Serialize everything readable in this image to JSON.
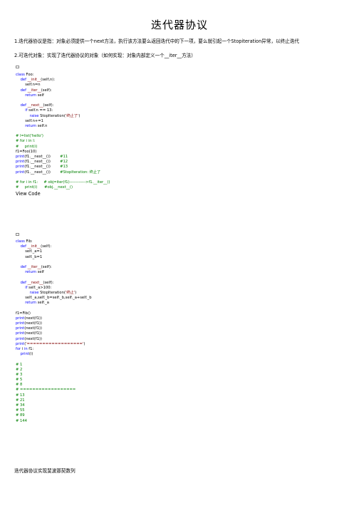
{
  "title": "迭代器协议",
  "paragraphs": [
    "1.迭代器协议是指：对象必须提供一个next方法，执行该方法要么返回迭代中的下一项，要么就引起一个Stopiteration异常，以终止迭代",
    "2.可迭代对象：实现了迭代器协议的对象（如何实现：对象内部定义一个__iter__方法）"
  ],
  "view_code_label": "View Code",
  "footer_text": "迭代器协议实现斐波那契数列",
  "code_block_1": [
    [
      {
        "c": "kw",
        "t": "class "
      },
      {
        "c": "plain",
        "t": "Foo:"
      }
    ],
    [
      {
        "c": "plain",
        "t": "    "
      },
      {
        "c": "kw",
        "t": "def "
      },
      {
        "c": "fn",
        "t": "__init__"
      },
      {
        "c": "plain",
        "t": "(self,n):"
      }
    ],
    [
      {
        "c": "plain",
        "t": "        self.n=n"
      }
    ],
    [
      {
        "c": "plain",
        "t": "    "
      },
      {
        "c": "kw",
        "t": "def "
      },
      {
        "c": "fn",
        "t": "__iter__"
      },
      {
        "c": "plain",
        "t": "(self):"
      }
    ],
    [
      {
        "c": "plain",
        "t": "        "
      },
      {
        "c": "kw",
        "t": "return "
      },
      {
        "c": "plain",
        "t": "self"
      }
    ],
    [
      {
        "c": "plain",
        "t": ""
      }
    ],
    [
      {
        "c": "plain",
        "t": "    "
      },
      {
        "c": "kw",
        "t": "def "
      },
      {
        "c": "fn",
        "t": "__next__"
      },
      {
        "c": "plain",
        "t": "(self):"
      }
    ],
    [
      {
        "c": "plain",
        "t": "        "
      },
      {
        "c": "kw",
        "t": "if "
      },
      {
        "c": "plain",
        "t": "self.n == 13:"
      }
    ],
    [
      {
        "c": "plain",
        "t": "            "
      },
      {
        "c": "kw",
        "t": "raise "
      },
      {
        "c": "plain",
        "t": "StopIteration("
      },
      {
        "c": "str",
        "t": "'终止了'"
      },
      {
        "c": "plain",
        "t": ")"
      }
    ],
    [
      {
        "c": "plain",
        "t": "        self.n+=1"
      }
    ],
    [
      {
        "c": "plain",
        "t": "        "
      },
      {
        "c": "kw",
        "t": "return "
      },
      {
        "c": "plain",
        "t": "self.n"
      }
    ],
    [
      {
        "c": "plain",
        "t": ""
      }
    ],
    [
      {
        "c": "cm",
        "t": "# l=list('hello')"
      }
    ],
    [
      {
        "c": "cm",
        "t": "# for i in l:"
      }
    ],
    [
      {
        "c": "cm",
        "t": "#     print(i)"
      }
    ],
    [
      {
        "c": "plain",
        "t": "f1=Foo(10)"
      }
    ],
    [
      {
        "c": "kw",
        "t": "print"
      },
      {
        "c": "plain",
        "t": "(f1.__next__())        "
      },
      {
        "c": "cm",
        "t": "#11"
      }
    ],
    [
      {
        "c": "kw",
        "t": "print"
      },
      {
        "c": "plain",
        "t": "(f1.__next__())        "
      },
      {
        "c": "cm",
        "t": "#12"
      }
    ],
    [
      {
        "c": "kw",
        "t": "print"
      },
      {
        "c": "plain",
        "t": "(f1.__next__())        "
      },
      {
        "c": "cm",
        "t": "#13"
      }
    ],
    [
      {
        "c": "kw",
        "t": "print"
      },
      {
        "c": "plain",
        "t": "(f1.__next__())        "
      },
      {
        "c": "cm",
        "t": "#StopIteration: 终止了"
      }
    ],
    [
      {
        "c": "plain",
        "t": ""
      }
    ],
    [
      {
        "c": "cm",
        "t": "# for i in f1:     # obj=iter(f1)------------>f1.__iter__()"
      }
    ],
    [
      {
        "c": "cm",
        "t": "#     print(i)      #obj.__next__()"
      }
    ]
  ],
  "code_block_2": [
    [
      {
        "c": "kw",
        "t": "class "
      },
      {
        "c": "plain",
        "t": "Fib:"
      }
    ],
    [
      {
        "c": "plain",
        "t": "    "
      },
      {
        "c": "kw",
        "t": "def "
      },
      {
        "c": "fn",
        "t": "__init__"
      },
      {
        "c": "plain",
        "t": "(self):"
      }
    ],
    [
      {
        "c": "plain",
        "t": "        self._a=1"
      }
    ],
    [
      {
        "c": "plain",
        "t": "        self._b=1"
      }
    ],
    [
      {
        "c": "plain",
        "t": ""
      }
    ],
    [
      {
        "c": "plain",
        "t": "    "
      },
      {
        "c": "kw",
        "t": "def "
      },
      {
        "c": "fn",
        "t": "__iter__"
      },
      {
        "c": "plain",
        "t": "(self):"
      }
    ],
    [
      {
        "c": "plain",
        "t": "        "
      },
      {
        "c": "kw",
        "t": "return "
      },
      {
        "c": "plain",
        "t": "self"
      }
    ],
    [
      {
        "c": "plain",
        "t": ""
      }
    ],
    [
      {
        "c": "plain",
        "t": "    "
      },
      {
        "c": "kw",
        "t": "def "
      },
      {
        "c": "fn",
        "t": "__next__"
      },
      {
        "c": "plain",
        "t": "(self):"
      }
    ],
    [
      {
        "c": "plain",
        "t": "        "
      },
      {
        "c": "kw",
        "t": "if "
      },
      {
        "c": "plain",
        "t": "self._a>100:"
      }
    ],
    [
      {
        "c": "plain",
        "t": "            "
      },
      {
        "c": "kw",
        "t": "raise "
      },
      {
        "c": "plain",
        "t": "StopIteration("
      },
      {
        "c": "str",
        "t": "'终止'"
      },
      {
        "c": "plain",
        "t": ")"
      }
    ],
    [
      {
        "c": "plain",
        "t": "        self._a,self._b=self._b,self._a+self._b"
      }
    ],
    [
      {
        "c": "plain",
        "t": "        "
      },
      {
        "c": "kw",
        "t": "return "
      },
      {
        "c": "plain",
        "t": "self._a"
      }
    ],
    [
      {
        "c": "plain",
        "t": ""
      }
    ],
    [
      {
        "c": "plain",
        "t": "f1=Fib()"
      }
    ],
    [
      {
        "c": "kw",
        "t": "print"
      },
      {
        "c": "plain",
        "t": "(next(f1))"
      }
    ],
    [
      {
        "c": "kw",
        "t": "print"
      },
      {
        "c": "plain",
        "t": "(next(f1))"
      }
    ],
    [
      {
        "c": "kw",
        "t": "print"
      },
      {
        "c": "plain",
        "t": "(next(f1))"
      }
    ],
    [
      {
        "c": "kw",
        "t": "print"
      },
      {
        "c": "plain",
        "t": "(next(f1))"
      }
    ],
    [
      {
        "c": "kw",
        "t": "print"
      },
      {
        "c": "plain",
        "t": "(next(f1))"
      }
    ],
    [
      {
        "c": "kw",
        "t": "print"
      },
      {
        "c": "plain",
        "t": "("
      },
      {
        "c": "str",
        "t": "'=================='"
      },
      {
        "c": "plain",
        "t": ")"
      }
    ],
    [
      {
        "c": "kw",
        "t": "for "
      },
      {
        "c": "plain",
        "t": "i "
      },
      {
        "c": "kw",
        "t": "in "
      },
      {
        "c": "plain",
        "t": "f1:"
      }
    ],
    [
      {
        "c": "plain",
        "t": "    "
      },
      {
        "c": "kw",
        "t": "print"
      },
      {
        "c": "plain",
        "t": "(i)"
      }
    ],
    [
      {
        "c": "plain",
        "t": ""
      }
    ],
    [
      {
        "c": "cm",
        "t": "# 1"
      }
    ],
    [
      {
        "c": "cm",
        "t": "# 2"
      }
    ],
    [
      {
        "c": "cm",
        "t": "# 3"
      }
    ],
    [
      {
        "c": "cm",
        "t": "# 5"
      }
    ],
    [
      {
        "c": "cm",
        "t": "# 8"
      }
    ],
    [
      {
        "c": "cm",
        "t": "# =================="
      }
    ],
    [
      {
        "c": "cm",
        "t": "# 13"
      }
    ],
    [
      {
        "c": "cm",
        "t": "# 21"
      }
    ],
    [
      {
        "c": "cm",
        "t": "# 34"
      }
    ],
    [
      {
        "c": "cm",
        "t": "# 55"
      }
    ],
    [
      {
        "c": "cm",
        "t": "# 89"
      }
    ],
    [
      {
        "c": "cm",
        "t": "# 144"
      }
    ]
  ]
}
